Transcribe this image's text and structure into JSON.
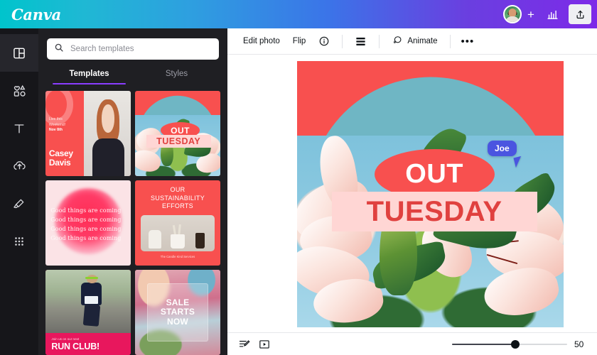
{
  "header": {
    "brand": "Canva",
    "avatar_name": "user-avatar",
    "add_label": "+",
    "icons": {
      "stats": "chart-icon",
      "share": "share-icon"
    }
  },
  "rail": {
    "items": [
      {
        "name": "templates",
        "icon": "layout-template-icon",
        "active": true
      },
      {
        "name": "elements",
        "icon": "shapes-icon",
        "active": false
      },
      {
        "name": "text",
        "icon": "text-icon",
        "active": false
      },
      {
        "name": "uploads",
        "icon": "cloud-upload-icon",
        "active": false
      },
      {
        "name": "draw",
        "icon": "pen-icon",
        "active": false
      },
      {
        "name": "apps",
        "icon": "grid-apps-icon",
        "active": false
      }
    ]
  },
  "panel": {
    "search": {
      "placeholder": "Search templates",
      "value": "",
      "icon": "search-icon"
    },
    "tabs": [
      {
        "label": "Templates",
        "active": true
      },
      {
        "label": "Styles",
        "active": false
      }
    ],
    "templates": [
      {
        "id": "casey-davis",
        "lead_line1": "Live this",
        "lead_line2": "Weekend!",
        "lead_date": "Nov 8th",
        "name": "Casey",
        "surname": "Davis"
      },
      {
        "id": "out-tuesday",
        "label_out": "OUT",
        "label_day": "TUESDAY"
      },
      {
        "id": "good-things",
        "line": "Good things are coming",
        "repeat": 4
      },
      {
        "id": "sustainability",
        "title_line1": "OUR",
        "title_line2": "SUSTAINABILITY",
        "title_line3": "EFFORTS",
        "footer": "The Candle Kind Services"
      },
      {
        "id": "run-club",
        "sub": "Join us on our next",
        "title": "RUN CLUB!"
      },
      {
        "id": "sale-starts-now",
        "line1": "SALE",
        "line2": "STARTS",
        "line3": "NOW"
      }
    ]
  },
  "toolbar": {
    "edit_photo": "Edit photo",
    "flip": "Flip",
    "info_icon": "info-icon",
    "position_icon": "position-layers-icon",
    "animate": "Animate",
    "animate_icon": "animate-icon",
    "more": "•••"
  },
  "canvas": {
    "label_out": "OUT",
    "label_day": "TUESDAY",
    "collaborator": {
      "name": "Joe",
      "color": "#4a55e0"
    },
    "colors": {
      "background": "#f8504f",
      "circle": "#6fb6c4",
      "sky": "#8cc8e0",
      "label_pill": "#ffd6d4",
      "label_text": "#e0413f"
    }
  },
  "bottombar": {
    "notes_icon": "notes-icon",
    "present_icon": "present-icon",
    "zoom_value": "50",
    "zoom_percent": 55
  }
}
